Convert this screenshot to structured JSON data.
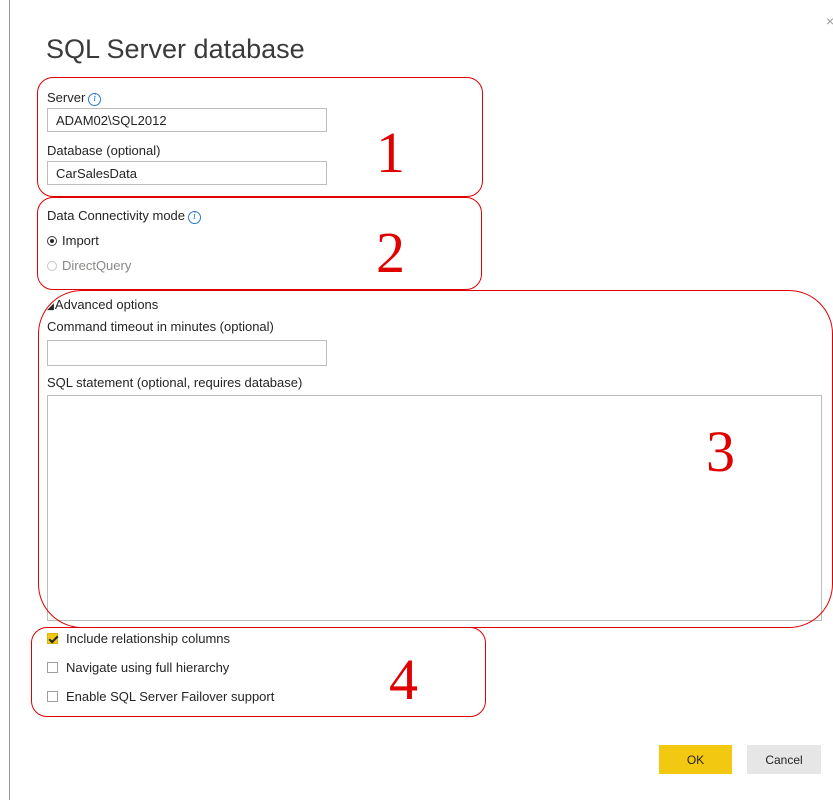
{
  "dialog": {
    "title": "SQL Server database",
    "close_glyph": "×"
  },
  "server": {
    "label": "Server",
    "value": "ADAM02\\SQL2012",
    "info_icon": "info-icon"
  },
  "database": {
    "label": "Database (optional)",
    "value": "CarSalesData"
  },
  "connectivity": {
    "label": "Data Connectivity mode",
    "options": [
      {
        "label": "Import",
        "selected": true
      },
      {
        "label": "DirectQuery",
        "selected": false
      }
    ]
  },
  "advanced": {
    "toggle_label": "Advanced options",
    "timeout_label": "Command timeout in minutes (optional)",
    "timeout_value": "",
    "sql_label": "SQL statement (optional, requires database)",
    "sql_value": ""
  },
  "checkboxes": [
    {
      "label": "Include relationship columns",
      "checked": true
    },
    {
      "label": "Navigate using full hierarchy",
      "checked": false
    },
    {
      "label": "Enable SQL Server Failover support",
      "checked": false
    }
  ],
  "annotations": [
    "1",
    "2",
    "3",
    "4"
  ],
  "buttons": {
    "ok": "OK",
    "cancel": "Cancel"
  },
  "colors": {
    "accent": "#f2c811",
    "annotation": "#e00000"
  }
}
